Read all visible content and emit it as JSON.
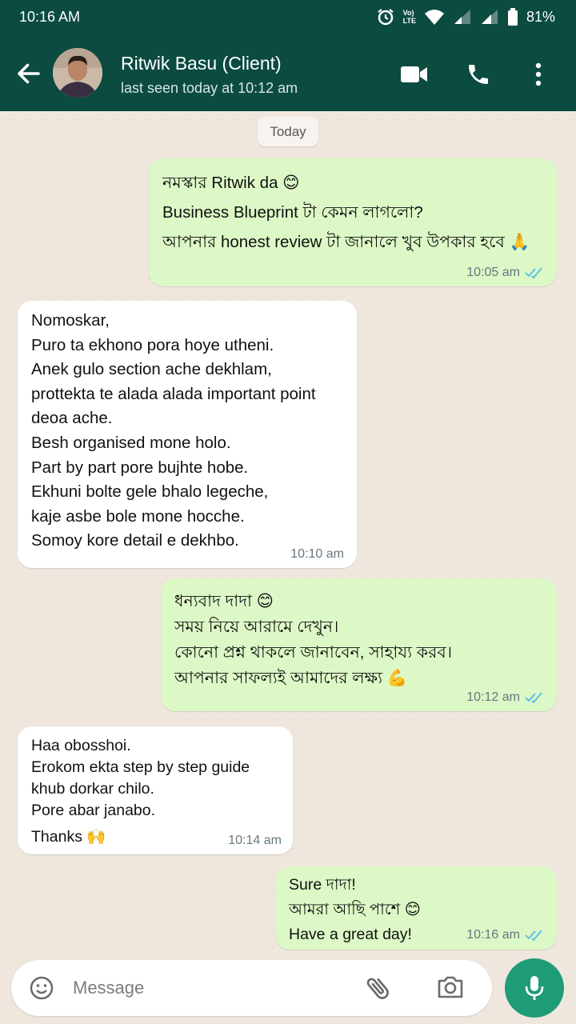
{
  "status": {
    "time": "10:16 AM",
    "volte": "Vo)",
    "lte": "LTE",
    "battery": "81%"
  },
  "header": {
    "contact_name": "Ritwik Basu (Client)",
    "last_seen": "last seen today at 10:12 am"
  },
  "chat": {
    "day_label": "Today",
    "messages": [
      {
        "direction": "out",
        "time": "10:05 am",
        "ticks": "read",
        "lines": [
          "নমস্কার Ritwik da 😊",
          "Business Blueprint টা কেমন লাগলো?",
          "আপনার honest review টা জানালে খুব উপকার হবে 🙏"
        ]
      },
      {
        "direction": "in",
        "time": "10:10 am",
        "lines": [
          "Nomoskar,",
          "Puro ta ekhono pora hoye utheni.",
          "Anek gulo section ache dekhlam,",
          "prottekta te alada alada important point",
          "deoa ache.",
          "Besh organised mone holo.",
          "Part by part pore bujhte hobe.",
          "Ekhuni bolte gele bhalo legeche,",
          "kaje asbe bole mone hocche.",
          "Somoy kore detail e dekhbo."
        ]
      },
      {
        "direction": "out",
        "time": "10:12 am",
        "ticks": "read",
        "lines": [
          "ধন্যবাদ দাদা 😊",
          "সময় নিয়ে আরামে দেখুন।",
          "কোনো প্রশ্ন থাকলে জানাবেন, সাহায্য করব।",
          "আপনার সাফল্যই আমাদের লক্ষ্য 💪"
        ]
      },
      {
        "direction": "in",
        "time": "10:14 am",
        "lines": [
          "Haa obosshoi.",
          "Erokom ekta step by step guide",
          "khub dorkar chilo.",
          "Pore abar janabo.",
          "Thanks 🙌"
        ]
      },
      {
        "direction": "out",
        "time": "10:16 am",
        "ticks": "read",
        "lines": [
          "Sure দাদা!",
          "আমরা আছি পাশে 😊",
          "Have a great day!"
        ]
      }
    ]
  },
  "composer": {
    "placeholder": "Message"
  },
  "colors": {
    "header": "#0b4b40",
    "outgoing_bubble": "#dcf8c6",
    "incoming_bubble": "#ffffff",
    "read_tick": "#53bdeb",
    "mic_button": "#1e9c77"
  },
  "icons": [
    "back-arrow-icon",
    "video-call-icon",
    "phone-icon",
    "more-vert-icon",
    "emoji-icon",
    "attach-icon",
    "camera-icon",
    "mic-icon"
  ]
}
